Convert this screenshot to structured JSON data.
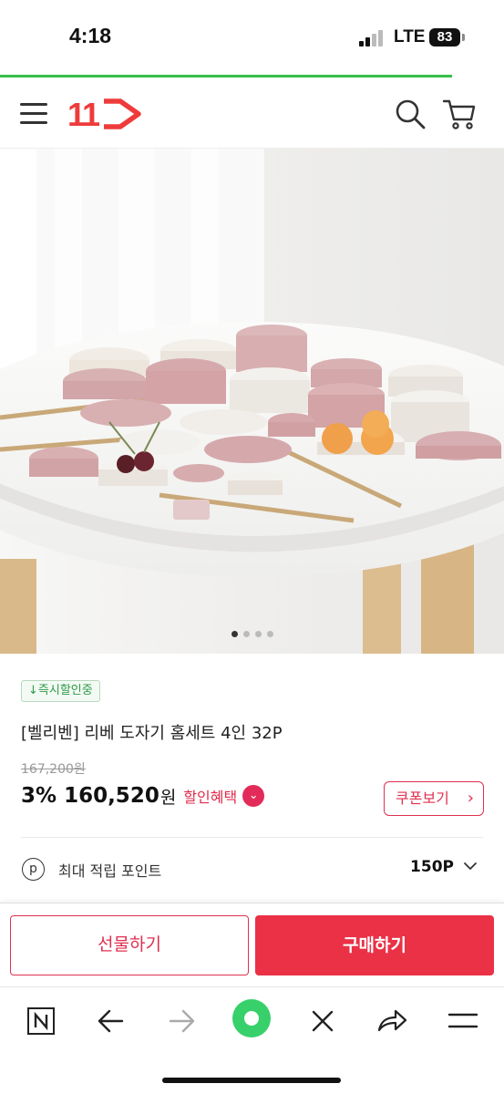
{
  "status_bar": {
    "time": "4:18",
    "network": "LTE",
    "battery": "83"
  },
  "header": {
    "logo_text": "11",
    "icons": [
      "menu-icon",
      "search-icon",
      "cart-icon"
    ],
    "brand_color": "#ee3b3b"
  },
  "product": {
    "image_alt": "pink and white ceramic tableware set on a round table",
    "carousel": {
      "total": 4,
      "active": 1
    },
    "badge": "↓즉시할인중",
    "title": "[벨리벤] 리베 도자기 홈세트 4인 32P",
    "original_price": "167,200원",
    "discount_rate": "3%",
    "sale_price": "160,520",
    "currency_unit": "원",
    "benefit_label": "할인혜택",
    "coupon_label": "쿠폰보기",
    "points_label": "최대 적립 포인트",
    "points_value": "150P"
  },
  "actions": {
    "gift_label": "선물하기",
    "buy_label": "구매하기",
    "accent_color": "#ea3146"
  },
  "browser_toolbar": {
    "items": [
      "naver-home-icon",
      "back-arrow-icon",
      "forward-arrow-icon",
      "green-dot-icon",
      "close-icon",
      "share-icon",
      "hamburger-icon"
    ]
  }
}
